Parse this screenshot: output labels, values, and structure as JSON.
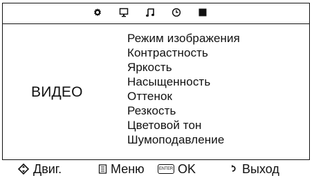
{
  "top_icons": [
    {
      "name": "settings-gear-icon"
    },
    {
      "name": "monitor-icon"
    },
    {
      "name": "music-note-icon"
    },
    {
      "name": "clock-icon"
    },
    {
      "name": "black-square-icon"
    }
  ],
  "section": {
    "label": "ВИДЕО"
  },
  "menu": {
    "items": [
      {
        "label": "Режим изображения"
      },
      {
        "label": "Контрастность"
      },
      {
        "label": "Яркость"
      },
      {
        "label": "Насыщенность"
      },
      {
        "label": "Оттенок"
      },
      {
        "label": "Резкость"
      },
      {
        "label": "Цветовой тон"
      },
      {
        "label": "Шумоподавление"
      }
    ]
  },
  "bottom": {
    "move_label": "Двиг.",
    "menu_label": "Меню",
    "enter_key_label": "ENTER",
    "ok_label": "OK",
    "exit_label": "Выход"
  }
}
